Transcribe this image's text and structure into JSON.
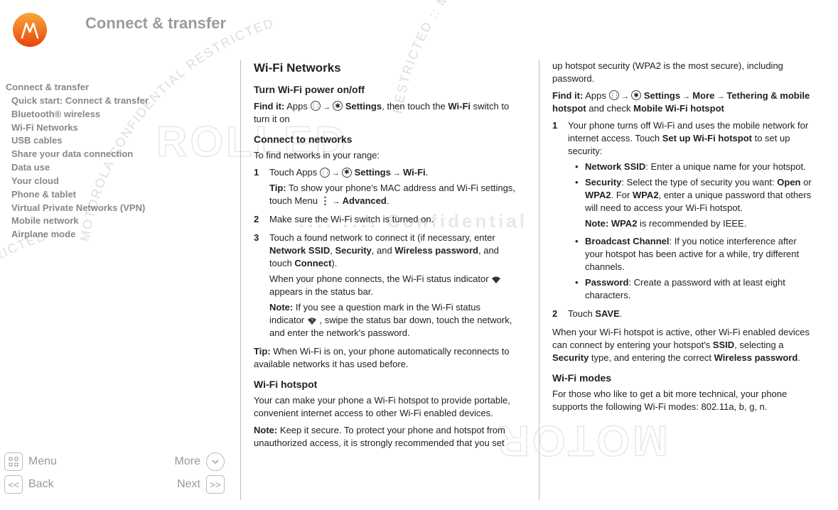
{
  "header": {
    "title": "Connect & transfer"
  },
  "sidebar": {
    "items": [
      "Connect & transfer",
      "Quick start: Connect & transfer",
      "Bluetooth® wireless",
      "Wi-Fi Networks",
      "USB cables",
      "Share your data connection",
      "Data use",
      "Your cloud",
      "Phone & tablet",
      "Virtual Private Networks (VPN)",
      "Mobile network",
      "Airplane mode"
    ]
  },
  "nav": {
    "menu": "Menu",
    "more": "More",
    "back": "Back",
    "next": "Next"
  },
  "col1": {
    "h_wifi_networks": "Wi-Fi Networks",
    "h_turn": "Turn Wi-Fi power on/off",
    "findit_label": "Find it:",
    "findit_apps": "Apps",
    "findit_settings": "Settings",
    "findit_tail": ", then touch the ",
    "findit_wifi": "Wi-Fi",
    "findit_tail2": " switch to turn it on",
    "h_connect": "Connect to networks",
    "p_find_range": "To find networks in your range:",
    "s1_a": "Touch Apps ",
    "s1_b": " Settings",
    "s1_c": " Wi-Fi",
    "s1_tip_a": "Tip:",
    "s1_tip_b": " To show your phone's MAC address and Wi-Fi settings, touch Menu ",
    "s1_tip_c": " Advanced",
    "s2": "Make sure the Wi-Fi switch is turned on.",
    "s3_a": "Touch a found network to connect it (if necessary, enter ",
    "s3_b": "Network SSID",
    "s3_c": "Security",
    "s3_d": "Wireless password",
    "s3_e": ", and touch ",
    "s3_f": "Connect",
    "s3_g": ").",
    "s3_p2a": "When your phone connects, the Wi-Fi status indicator ",
    "s3_p2b": " appears in the status bar.",
    "s3_note_a": "Note:",
    "s3_note_b": " If you see a question mark in the Wi-Fi status indicator ",
    "s3_note_c": ", swipe the status bar down, touch the network, and enter the network's password.",
    "tip2_a": "Tip:",
    "tip2_b": " When Wi-Fi is on, your phone automatically reconnects to available networks it has used before.",
    "h_hotspot": "Wi-Fi hotspot",
    "p_hotspot_intro": "Your can make your phone a Wi-Fi hotspot to provide portable, convenient internet access to other Wi-Fi enabled devices.",
    "hotspot_note_a": "Note:",
    "hotspot_note_b": " Keep it secure. To protect your phone and hotspot from unauthorized access, it is strongly recommended that you set "
  },
  "col2": {
    "cont": "up hotspot security (WPA2 is the most secure), including password.",
    "findit_label": "Find it:",
    "f_apps": "Apps",
    "f_settings": "Settings",
    "f_more": "More",
    "f_teth": "Tethering & mobile hotspot",
    "f_check": " and check ",
    "f_mwh": "Mobile Wi-Fi hotspot",
    "s1_a": "Your phone turns off Wi-Fi and uses the mobile network for internet access. Touch ",
    "s1_b": "Set up Wi-Fi hotspot",
    "s1_c": " to set up security:",
    "b_ssid_a": "Network SSID",
    "b_ssid_b": ": Enter a unique name for your hotspot.",
    "b_sec_a": "Security",
    "b_sec_b": ": Select the type of security you want: ",
    "b_sec_c": "Open",
    "b_sec_d": " or ",
    "b_sec_e": "WPA2",
    "b_sec_f": ". For ",
    "b_sec_g": "WPA2",
    "b_sec_h": ", enter a unique password that others will need to access your Wi-Fi hotspot.",
    "b_sec_note_a": "Note:",
    "b_sec_note_b": " WPA2",
    "b_sec_note_c": " is recommended by IEEE.",
    "b_bc_a": "Broadcast Channel",
    "b_bc_b": ": If you notice interference after your hotspot has been active for a while, try different channels.",
    "b_pw_a": "Password",
    "b_pw_b": ": Create a password with at least eight characters.",
    "s2_a": "Touch ",
    "s2_b": "SAVE",
    "s2_c": ".",
    "p_active_a": "When your Wi-Fi hotspot is active, other Wi-Fi enabled devices can connect by entering your hotspot's ",
    "p_active_b": "SSID",
    "p_active_c": ", selecting a ",
    "p_active_d": "Security",
    "p_active_e": " type, and entering the correct ",
    "p_active_f": "Wireless password",
    "p_active_g": ".",
    "h_modes": "Wi-Fi modes",
    "p_modes": "For those who like to get a bit more technical, your phone supports the following Wi-Fi modes: 802.11a, b, g, n."
  }
}
